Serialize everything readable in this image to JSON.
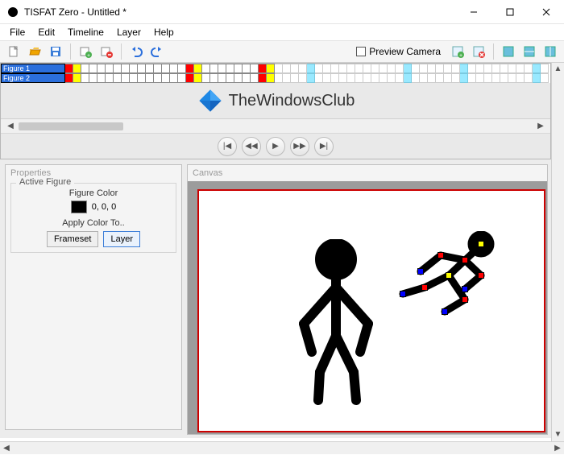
{
  "window": {
    "title": "TISFAT Zero - Untitled *"
  },
  "menu": {
    "file": "File",
    "edit": "Edit",
    "timeline": "Timeline",
    "layer": "Layer",
    "help": "Help"
  },
  "toolbar": {
    "new": "document",
    "open": "folder",
    "save": "disk",
    "insert_keyframe": "insert",
    "remove_keyframe": "remove",
    "undo": "undo",
    "redo": "redo",
    "preview_camera_label": "Preview Camera",
    "add_layer": "add",
    "del_layer": "delete",
    "display_a": "display_a",
    "display_b": "display_b",
    "display_c": "display_c"
  },
  "timeline": {
    "layers": [
      "Figure 1",
      "Figure 2"
    ],
    "keyframe_pairs": [
      0,
      15,
      24
    ],
    "highlight_columns": [
      30,
      42,
      49,
      58
    ]
  },
  "watermark": {
    "text": "TheWindowsClub"
  },
  "playback": {
    "first": "first",
    "prev": "prev",
    "play": "play",
    "next": "next",
    "last": "last"
  },
  "properties": {
    "panel_title": "Properties",
    "group_legend": "Active Figure",
    "figure_color_label": "Figure Color",
    "figure_color_value": "0, 0, 0",
    "apply_label": "Apply Color To..",
    "frameset_btn": "Frameset",
    "layer_btn": "Layer"
  },
  "canvas": {
    "panel_title": "Canvas"
  }
}
